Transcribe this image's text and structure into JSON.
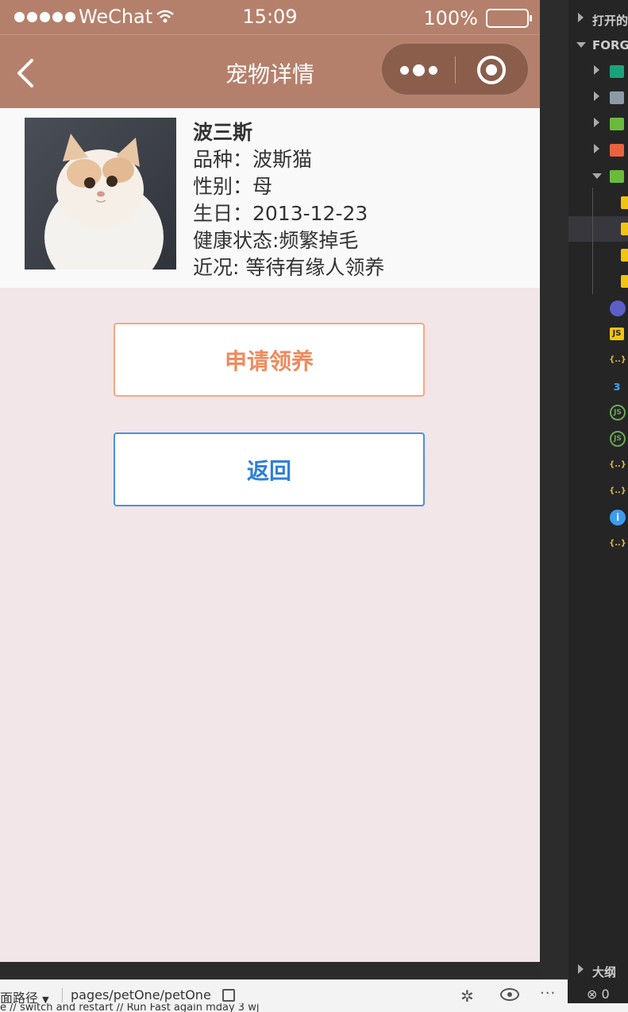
{
  "statusbar": {
    "carrier": "WeChat",
    "time": "15:09",
    "battery": "100%"
  },
  "navbar": {
    "title": "宠物详情"
  },
  "pet": {
    "name": "波三斯",
    "breed": "品种：波斯猫",
    "gender": "性别：母",
    "birthday": "生日：2013-12-23",
    "health": "健康状态:频繁掉毛",
    "status": "近况: 等待有缘人领养"
  },
  "buttons": {
    "adopt": "申请领养",
    "back": "返回"
  },
  "ide": {
    "opened_label": "打开的",
    "project_label": "FORGU",
    "outline_label": "大纲",
    "error_count": "0",
    "colors": {
      "css": "#3b9cf0",
      "js": "#f1c40f",
      "json": "#e2b93b",
      "node": "#6aa84f"
    }
  },
  "bottombar": {
    "page_path_label": "面路径",
    "page_path": "pages/petOne/petOne",
    "cut_text": "e // switch and restart // Run Fast again mday 3 wj"
  }
}
